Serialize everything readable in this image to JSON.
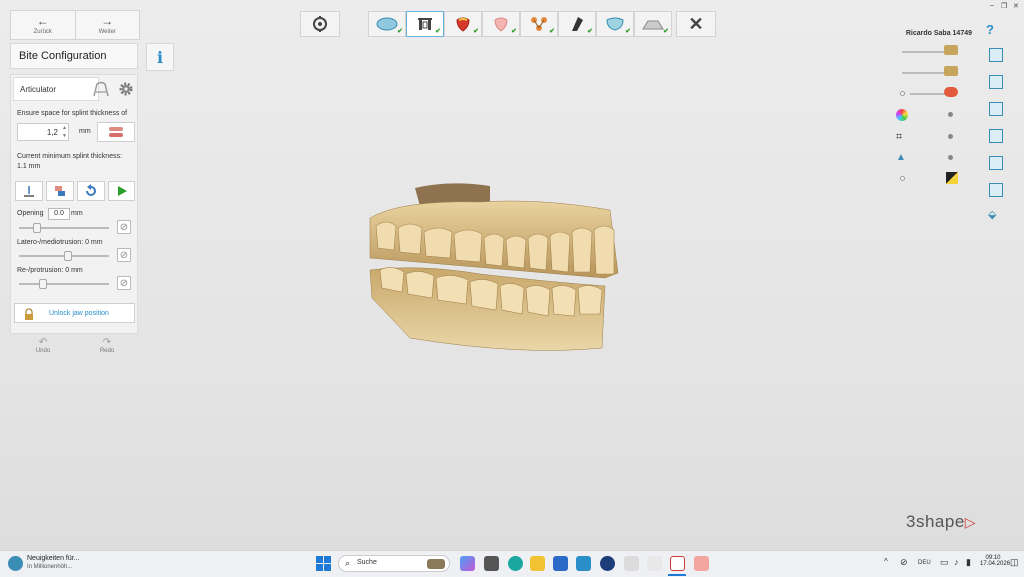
{
  "nav": {
    "back_label": "Zurück",
    "forward_label": "Weiter"
  },
  "panel": {
    "title": "Bite Configuration",
    "tab_label": "Articulator",
    "splint_label": "Ensure space for splint thickness of",
    "splint_value": "1,2",
    "splint_unit": "mm",
    "current_min_label": "Current minimum splint thickness:",
    "current_min_value": "1.1 mm",
    "opening_label": "Opening",
    "opening_value": "0.0",
    "opening_unit": "mm",
    "latero_label": "Latero-/mediotrusion: 0 mm",
    "protrusion_label": "Re-/protrusion: 0 mm",
    "unlock_label": "Unlock jaw position",
    "undo_label": "Undo",
    "redo_label": "Redo"
  },
  "right_panel": {
    "patient_name": "Ricardo Saba 14749",
    "help_icon": "?"
  },
  "brand": "3shape",
  "taskbar": {
    "news_line1": "Neuigkeiten für...",
    "news_line2": "In Millionenhöh...",
    "search_label": "Suche",
    "lang": "DEU",
    "time": "09:10",
    "date": "17.04.2026"
  },
  "colors": {
    "accent": "#2a8fc9",
    "model": "#d9c08a",
    "check": "#2ca02c"
  }
}
